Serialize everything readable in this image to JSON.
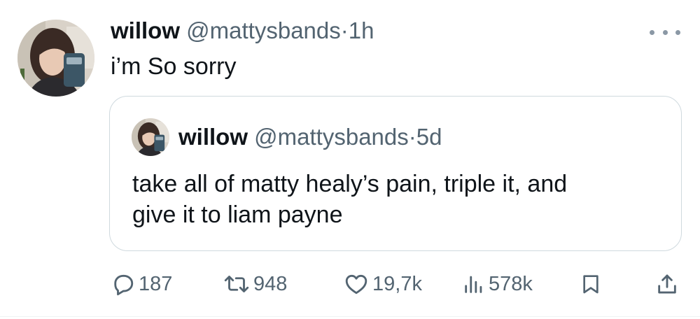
{
  "tweet": {
    "author": {
      "name": "willow",
      "handle": "@mattysbands",
      "separator": "·",
      "time": "1h"
    },
    "text": "i’m So sorry",
    "more_icon": "more-horizontal-icon"
  },
  "quoted_tweet": {
    "author": {
      "name": "willow",
      "handle": "@mattysbands",
      "separator": "·",
      "time": "5d"
    },
    "text_lines": [
      "take all of matty healy’s pain, triple it, and",
      "give it to liam payne"
    ]
  },
  "actions": {
    "replies": "187",
    "retweets": "948",
    "likes": "19,7k",
    "views": "578k",
    "icons": [
      "reply-icon",
      "retweet-icon",
      "like-icon",
      "views-icon",
      "bookmark-icon",
      "share-icon"
    ]
  },
  "colors": {
    "text": "#0f1419",
    "secondary": "#536471",
    "border": "#cfd9de"
  }
}
